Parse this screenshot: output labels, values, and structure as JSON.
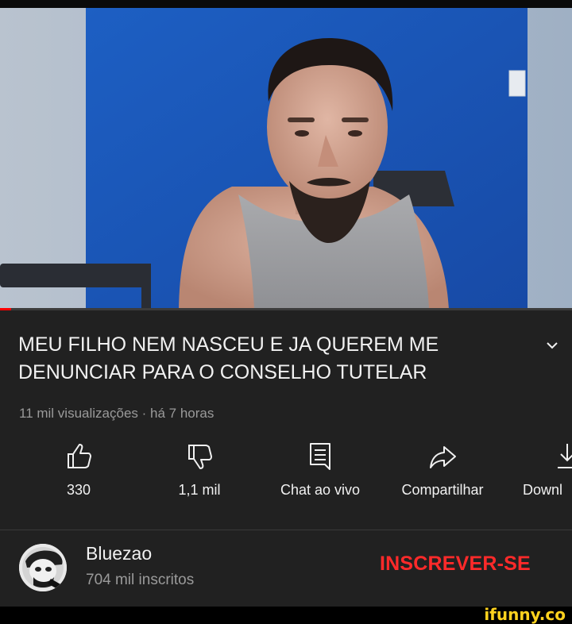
{
  "video": {
    "title_line1": "MEU FILHO NEM NASCEU E JA QUEREM ME",
    "title_line2": "DENUNCIAR PARA O CONSELHO TUTELAR",
    "meta": "11 mil visualizações · há 7 horas",
    "progress_fraction": 0.02
  },
  "actions": {
    "like": {
      "label": "330",
      "icon": "thumbs-up-icon"
    },
    "dislike": {
      "label": "1,1 mil",
      "icon": "thumbs-down-icon"
    },
    "chat": {
      "label": "Chat ao vivo",
      "icon": "live-chat-icon"
    },
    "share": {
      "label": "Compartilhar",
      "icon": "share-icon"
    },
    "download": {
      "label": "Downl",
      "icon": "download-icon"
    }
  },
  "channel": {
    "name": "Bluezao",
    "subscribers": "704 mil inscritos",
    "subscribe_label": "INSCREVER-SE"
  },
  "watermark": "ifunny.co",
  "colors": {
    "panel_bg": "#212121",
    "text": "#f1f1f1",
    "secondary_text": "#9a9a9a",
    "subscribe": "#ff2a2a",
    "progress": "#ff0000",
    "wall_blue": "#1f55b6",
    "watermark": "#ffd21e"
  }
}
